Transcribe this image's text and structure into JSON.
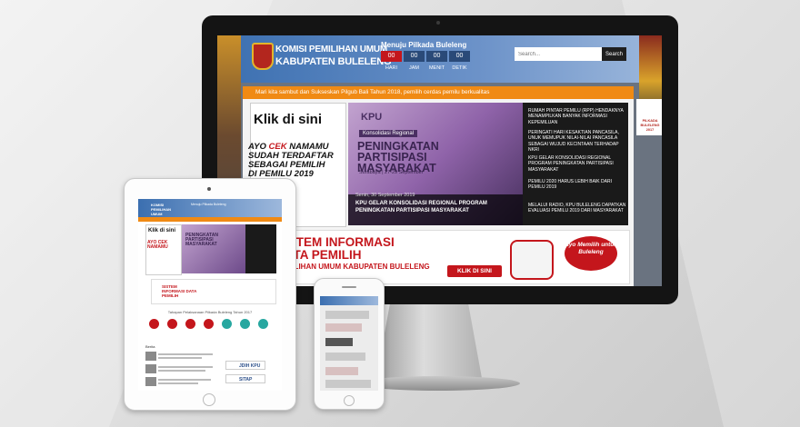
{
  "desktop": {
    "brand_line1": "KOMISI PEMILIHAN UMUM",
    "brand_line2": "KABUPATEN BULELENG",
    "countdown_title": "Menuju Pilkada Buleleng",
    "countdown_values": [
      "00",
      "00",
      "00",
      "00"
    ],
    "countdown_labels": [
      "HARI",
      "JAM",
      "MENIT",
      "DETIK"
    ],
    "search_placeholder": "Search...",
    "search_button": "Search",
    "welcome_text": "Mari kita sambut dan Sukseskan Pilgub Bali Tahun 2018, pemilih cerdas pemilu berkualitas",
    "ad_title": "Klik di sini",
    "ad_cek_pre": "AYO ",
    "ad_cek_red": "CEK",
    "ad_cek_post": " NAMAMU SUDAH TERDAFTAR SEBAGAI PEMILIH DI PEMILU 2019 BELUM?",
    "side_ad": "PILKADA BULELENG 2017",
    "slide_logo": "KPU",
    "slide_tag": "Konsolidasi Regional",
    "slide_heading": "PENINGKATAN PARTISIPASI MASYARAKAT",
    "slide_location": "Surabaya | 27-29 September",
    "slide_date": "Senin, 30 September 2019",
    "slide_title": "KPU GELAR KONSOLIDASI REGIONAL PROGRAM PENINGKATAN PARTISIPASI MASYARAKAT",
    "news": [
      "RUMAH PINTAR PEMILU (RPP) HENDAKNYA MENAMPILKAN BANYAK INFORMASI KEPEMILUAN",
      "PERINGATI HARI KESAKTIAN PANCASILA, UNUK MEMUPUK NILAI-NILAI PANCASILA SEBAGAI WUJUD KECINTAAN TERHADAP NKRI",
      "KPU GELAR KONSOLIDASI REGIONAL PROGRAM PENINGKATAN PARTISIPASI MASYARAKAT",
      "PEMILU 2020 HARUS LEBIH BAIK DARI PEMILU 2019",
      "MELALUI RADIO, KPU BULELENG DAPATKAN EVALUASI PEMILU 2019 DARI MASYARAKAT"
    ],
    "sis_line1": "SISTEM INFORMASI",
    "sis_line2": "DATA PEMILIH",
    "sis_line3": "PEMILIHAN UMUM KABUPATEN BULELENG",
    "klik_button": "KLIK DI SINI",
    "ayo_badge": "Ayo Memilih untuk Buleleng"
  },
  "tablet": {
    "brand": "KOMISI PEMILIHAN UMUM KABUPATEN BULELENG",
    "countdown_title": "Menuju Pilkada Buleleng",
    "ad_title": "Klik di sini",
    "ad_cek": "AYO CEK NAMAMU",
    "slide_heading": "PENINGKATAN PARTISIPASI MASYARAKAT",
    "sis_text": "SISTEM INFORMASI DATA PEMILIH",
    "tahapan": "Tahapan Pelaksanaan Pilkada Buleleng Tahun 2017",
    "berita": "Berita",
    "side_links": [
      "JDIH KPU",
      "SITAP"
    ]
  },
  "colors": {
    "accent_orange": "#f08a14",
    "kpu_red": "#c4161c",
    "header_blue": "#3b6fb0"
  }
}
